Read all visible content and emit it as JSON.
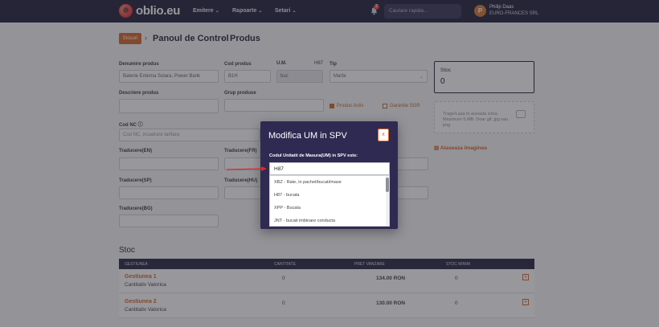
{
  "topbar": {
    "brand": "oblio.eu",
    "nav": [
      {
        "label": "Emitere",
        "icon": "chevron-down-icon"
      },
      {
        "label": "Rapoarte",
        "icon": "chevron-down-icon"
      },
      {
        "label": "Setari",
        "icon": "chevron-down-icon"
      }
    ],
    "notification_count": "2",
    "search_placeholder": "Cautare rapida...",
    "user": {
      "initial": "P",
      "name": "Philip Daas",
      "company": "EURO-FRANCES SRL"
    }
  },
  "breadcrumb": {
    "badge": "Stocuri",
    "items": [
      "Panoul de Control",
      "Produs"
    ]
  },
  "form": {
    "denumire_label": "Denumire produs",
    "denumire_value": "Baterie Externa Solara, Power Bank",
    "cod_label": "Cod produs",
    "cod_value": "B1H",
    "um_label": "U.M.",
    "um_code": "H87",
    "um_value": "buc",
    "tip_label": "Tip",
    "tip_value": "Marfa",
    "descriere_label": "Descriere produs",
    "grup_label": "Grup produse",
    "produs_activ": "Produs Activ",
    "garantie_sgr": "Garantie SGR",
    "cod_nc_label": "Cod NC",
    "cod_nc_placeholder": "Cod NC, incadrare tarifara",
    "trad_en": "Traducere(EN)",
    "trad_fr": "Traducere(FR)",
    "trad_sp": "Traducere(SP)",
    "trad_hu": "Traducere(HU)",
    "trad_bg": "Traducere(BG)"
  },
  "side": {
    "stoc_label": "Stoc",
    "stoc_value": "0",
    "drop_text": "Trage/Lasa in aceasta zona. Maximum 5 MB. Doar gif, jpg sau png",
    "attach_label": "Ataseaza Imaginea"
  },
  "stock_table": {
    "title": "Stoc",
    "headers": [
      "GESTIUNEA",
      "CANTITATE",
      "PRET VANZARE",
      "STOC MINIM"
    ],
    "rows": [
      {
        "gestiune": "Gestiunea 1",
        "metoda": "Cantitativ Valorica",
        "cantitate": "0",
        "pret": "134.00 RON",
        "minim": "0"
      },
      {
        "gestiune": "Gestiunea 2",
        "metoda": "Cantitativ Valorica",
        "cantitate": "0",
        "pret": "130.00 RON",
        "minim": "0"
      }
    ]
  },
  "modal": {
    "title": "Modifica UM in SPV",
    "close": "x",
    "field_label": "Codul Unitatii de Masura(UM) in SPV este:",
    "input_value": "H87",
    "options": [
      "XBZ - Rate, in pachet/bucati/mase",
      "H87 - bucata",
      "XPP - Bucata",
      "JNT - bucati imbinare conducta"
    ]
  }
}
